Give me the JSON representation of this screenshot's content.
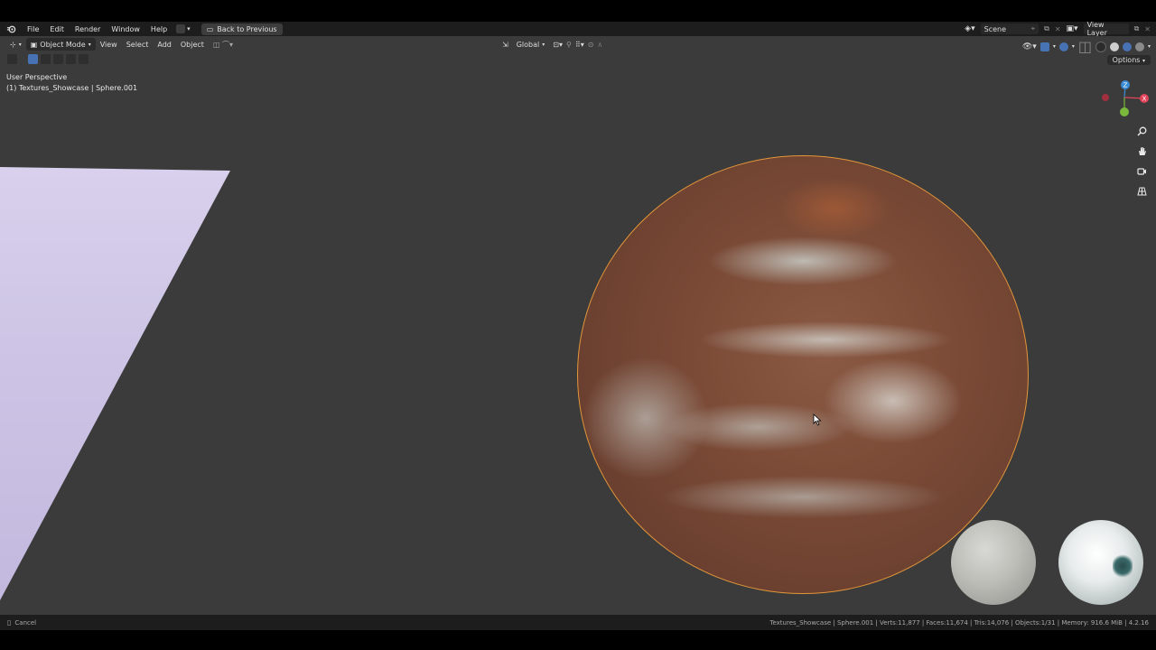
{
  "menubar": {
    "items": [
      "File",
      "Edit",
      "Render",
      "Window",
      "Help"
    ],
    "back_button": "Back to Previous",
    "scene": "Scene",
    "view_layer": "View Layer"
  },
  "viewport_header": {
    "mode": "Object Mode",
    "menus": [
      "View",
      "Select",
      "Add",
      "Object"
    ],
    "transform_orientation": "Global",
    "options": "Options"
  },
  "viewport": {
    "perspective": "User Perspective",
    "object_info": "(1) Textures_Showcase | Sphere.001"
  },
  "statusbar": {
    "left": "Cancel",
    "right": "Textures_Showcase | Sphere.001 | Verts:11,877 | Faces:11,674 | Tris:14,076 | Objects:1/31 | Memory: 916.6 MiB | 4.2.16"
  },
  "colors": {
    "accent": "#4772b3",
    "selection_outline": "#e3963a",
    "axis_x": "#e0435a",
    "axis_y": "#7ab93c",
    "axis_z": "#3a8bd6"
  }
}
